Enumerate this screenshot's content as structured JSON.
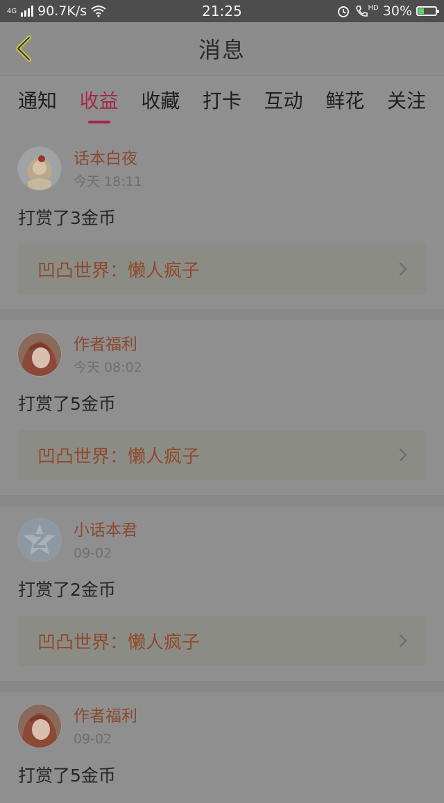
{
  "status_bar": {
    "network": "4G",
    "speed": "90.7K/s",
    "time": "21:25",
    "hd": "HD",
    "battery": "30%",
    "battery_level": 0.3
  },
  "header": {
    "title": "消息"
  },
  "tabs": [
    {
      "label": "通知",
      "active": false
    },
    {
      "label": "收益",
      "active": true
    },
    {
      "label": "收藏",
      "active": false
    },
    {
      "label": "打卡",
      "active": false
    },
    {
      "label": "互动",
      "active": false
    },
    {
      "label": "鲜花",
      "active": false
    },
    {
      "label": "关注",
      "active": false
    }
  ],
  "messages": [
    {
      "name": "话本白夜",
      "time": "今天 18:11",
      "action": "打赏了3金币",
      "link": "凹凸世界：懒人疯子",
      "avatar": "doll-avatar-icon"
    },
    {
      "name": "作者福利",
      "time": "今天 08:02",
      "action": "打赏了5金币",
      "link": "凹凸世界：懒人疯子",
      "avatar": "anime-girl-avatar-icon"
    },
    {
      "name": "小话本君",
      "time": "09-02",
      "action": "打赏了2金币",
      "link": "凹凸世界：懒人疯子",
      "avatar": "z-logo-avatar-icon"
    },
    {
      "name": "作者福利",
      "time": "09-02",
      "action": "打赏了5金币",
      "link": "",
      "avatar": "anime-girl-avatar-icon"
    }
  ],
  "colors": {
    "accent": "#a82150",
    "name_text": "#8a4a30",
    "background": "#8f8f8f"
  }
}
